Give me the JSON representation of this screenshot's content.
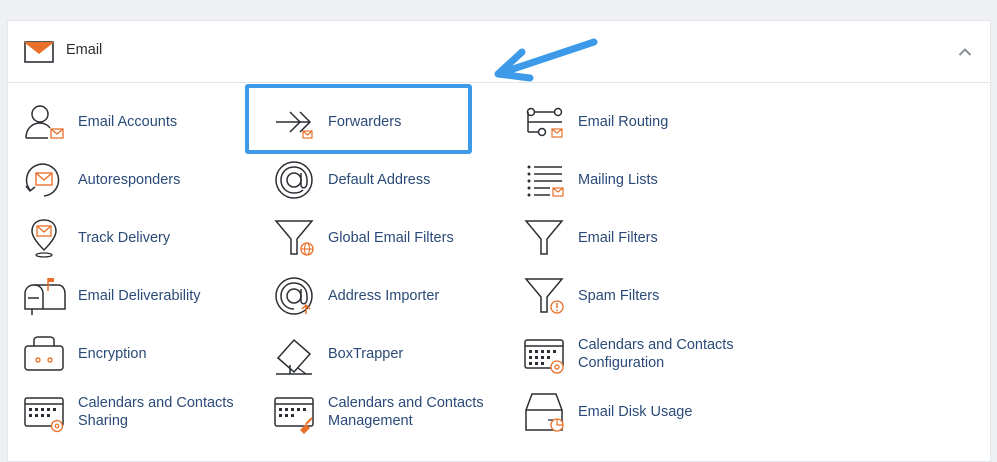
{
  "section": {
    "title": "Email",
    "icon": "envelope-icon",
    "collapse_icon": "chevron-up-icon"
  },
  "colors": {
    "link": "#2a4a78",
    "accent": "#e8702a",
    "highlight": "#3d9ae8",
    "icon_stroke": "#2b2f33"
  },
  "items": [
    {
      "label": "Email Accounts",
      "icon": "user-mail-icon"
    },
    {
      "label": "Forwarders",
      "icon": "forward-arrow-icon"
    },
    {
      "label": "Email Routing",
      "icon": "routing-icon"
    },
    {
      "label": "Autoresponders",
      "icon": "autoresponder-icon"
    },
    {
      "label": "Default Address",
      "icon": "at-sign-icon"
    },
    {
      "label": "Mailing Lists",
      "icon": "mailing-list-icon"
    },
    {
      "label": "Track Delivery",
      "icon": "location-pin-icon"
    },
    {
      "label": "Global Email Filters",
      "icon": "global-filter-icon"
    },
    {
      "label": "Email Filters",
      "icon": "filter-icon"
    },
    {
      "label": "Email Deliverability",
      "icon": "mailbox-icon"
    },
    {
      "label": "Address Importer",
      "icon": "at-import-icon"
    },
    {
      "label": "Spam Filters",
      "icon": "spam-filter-icon"
    },
    {
      "label": "Encryption",
      "icon": "encryption-key-icon"
    },
    {
      "label": "BoxTrapper",
      "icon": "box-trap-icon"
    },
    {
      "label": "Calendars and Contacts Configuration",
      "icon": "calendar-config-icon"
    },
    {
      "label": "Calendars and Contacts Sharing",
      "icon": "calendar-share-icon"
    },
    {
      "label": "Calendars and Contacts Management",
      "icon": "calendar-manage-icon"
    },
    {
      "label": "Email Disk Usage",
      "icon": "disk-usage-icon"
    }
  ]
}
